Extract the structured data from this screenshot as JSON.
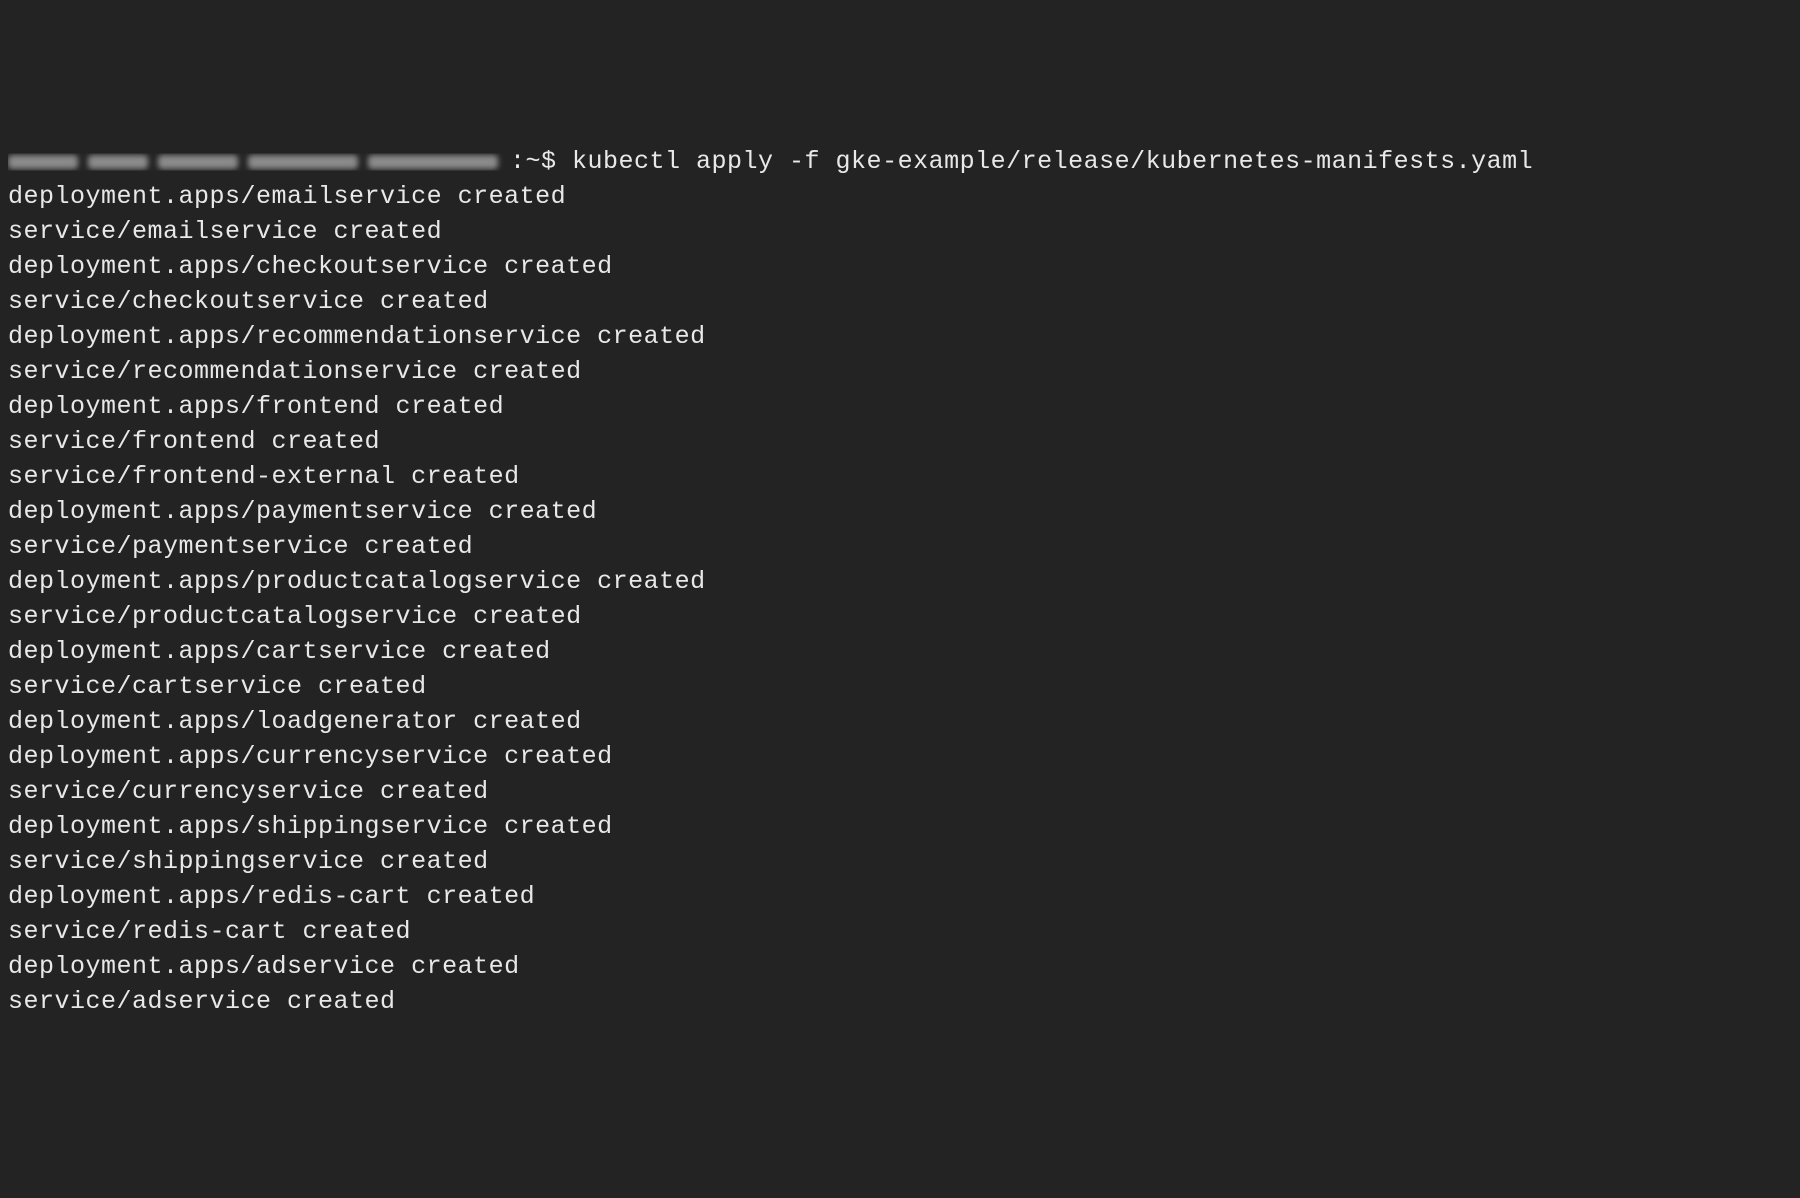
{
  "prompt": {
    "suffix": ":~$ ",
    "command": "kubectl apply -f gke-example/release/kubernetes-manifests.yaml"
  },
  "output": [
    "deployment.apps/emailservice created",
    "service/emailservice created",
    "deployment.apps/checkoutservice created",
    "service/checkoutservice created",
    "deployment.apps/recommendationservice created",
    "service/recommendationservice created",
    "deployment.apps/frontend created",
    "service/frontend created",
    "service/frontend-external created",
    "deployment.apps/paymentservice created",
    "service/paymentservice created",
    "deployment.apps/productcatalogservice created",
    "service/productcatalogservice created",
    "deployment.apps/cartservice created",
    "service/cartservice created",
    "deployment.apps/loadgenerator created",
    "deployment.apps/currencyservice created",
    "service/currencyservice created",
    "deployment.apps/shippingservice created",
    "service/shippingservice created",
    "deployment.apps/redis-cart created",
    "service/redis-cart created",
    "deployment.apps/adservice created",
    "service/adservice created"
  ]
}
